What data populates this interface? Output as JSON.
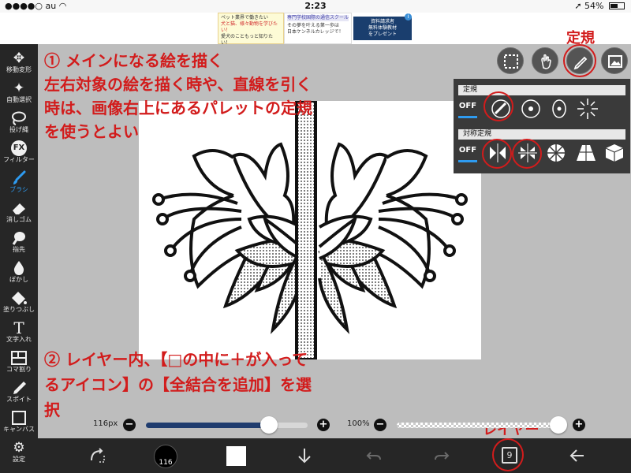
{
  "status_bar": {
    "carrier": "au",
    "time": "2:23",
    "battery": "54%"
  },
  "ad": {
    "block1": [
      "ペット業界で働きたい",
      "犬と猫、様々動物を学びたい！",
      "愛犬のこともっと知りたい！"
    ],
    "block2_header": "専門学校国際の通信スクール",
    "block2": [
      "その夢を叶える第一歩は",
      "日本ケンネルカレッジで！"
    ],
    "block3": [
      "資料請求者",
      "無料体験教材",
      "をプレゼント"
    ],
    "info_icon": "i"
  },
  "annotations": {
    "step1": [
      "① メインになる絵を描く",
      "左右対象の絵を描く時や、直線を引く",
      "時は、画像右上にあるパレットの定規",
      "を使うとよい"
    ],
    "step2": [
      "② レイヤー内、【□の中に＋が入って",
      "るアイコン】の【全結合を追加】を選",
      "択"
    ],
    "ruler_label": "定規",
    "layer_label": "レイヤー"
  },
  "toolbar": {
    "tools": [
      {
        "label": "移動変形",
        "icon": "move-icon"
      },
      {
        "label": "自動選択",
        "icon": "magic-wand-icon"
      },
      {
        "label": "投げ縄",
        "icon": "lasso-icon"
      },
      {
        "label": "フィルター",
        "icon": "fx-icon"
      },
      {
        "label": "ブラシ",
        "icon": "brush-icon"
      },
      {
        "label": "消しゴム",
        "icon": "eraser-icon"
      },
      {
        "label": "指先",
        "icon": "finger-icon"
      },
      {
        "label": "ぼかし",
        "icon": "drop-icon"
      },
      {
        "label": "塗りつぶし",
        "icon": "bucket-icon"
      },
      {
        "label": "文字入れ",
        "icon": "text-icon"
      },
      {
        "label": "コマ割り",
        "icon": "frame-icon"
      },
      {
        "label": "スポイト",
        "icon": "eyedropper-icon"
      },
      {
        "label": "キャンバス",
        "icon": "canvas-icon"
      },
      {
        "label": "設定",
        "icon": "gear-icon"
      }
    ],
    "active": "ブラシ",
    "fx_glyph": "FX",
    "text_glyph": "T"
  },
  "ruler_panel": {
    "section1": "定規",
    "section2": "対称定規",
    "off_label": "OFF"
  },
  "controls": {
    "brush_size": "116px",
    "brush_size_fraction": 0.76,
    "opacity": "100%",
    "opacity_fraction": 1.0,
    "minus": "−",
    "plus": "+"
  },
  "bottom_bar": {
    "brush_number": "116",
    "layer_count": "9"
  },
  "colors": {
    "toolbar_bg": "#262626",
    "accent_blue": "#2e9bf0",
    "annotation_red": "#d21c1c",
    "panel_bg": "#3a3a3a"
  }
}
